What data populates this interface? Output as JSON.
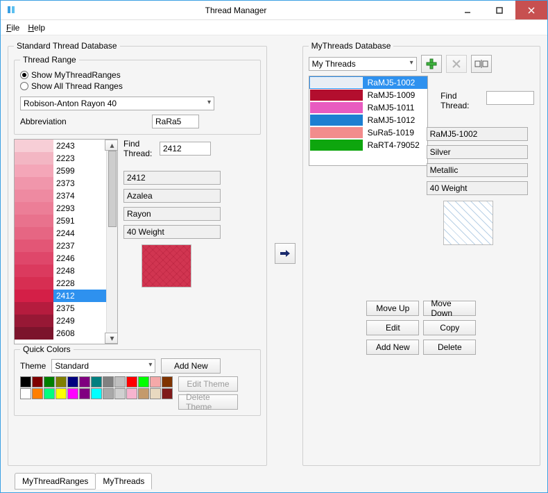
{
  "window": {
    "title": "Thread Manager"
  },
  "menu": {
    "file": "File",
    "help": "Help"
  },
  "left": {
    "group_title": "Standard Thread Database",
    "range_group_title": "Thread Range",
    "radio_my": "Show MyThreadRanges",
    "radio_all": "Show All Thread Ranges",
    "range_combo": "Robison-Anton Rayon 40",
    "abbrev_label": "Abbreviation",
    "abbrev_value": "RaRa5",
    "find_label": "Find Thread:",
    "find_value": "2412",
    "detail_id": "2412",
    "detail_name": "Azalea",
    "detail_material": "Rayon",
    "detail_weight": "40 Weight",
    "threads": [
      {
        "num": "2243",
        "color": "#f7ced6"
      },
      {
        "num": "2223",
        "color": "#f3b6c3"
      },
      {
        "num": "2599",
        "color": "#f4a6b8"
      },
      {
        "num": "2373",
        "color": "#f096ab"
      },
      {
        "num": "2374",
        "color": "#ee8aa1"
      },
      {
        "num": "2293",
        "color": "#ec7e97"
      },
      {
        "num": "2591",
        "color": "#e9728d"
      },
      {
        "num": "2244",
        "color": "#e66683"
      },
      {
        "num": "2237",
        "color": "#e35676"
      },
      {
        "num": "2246",
        "color": "#df476a"
      },
      {
        "num": "2248",
        "color": "#db3a5e"
      },
      {
        "num": "2228",
        "color": "#d72e52"
      },
      {
        "num": "2412",
        "color": "#d41f47",
        "selected": true
      },
      {
        "num": "2375",
        "color": "#b51c3e"
      },
      {
        "num": "2249",
        "color": "#971835"
      },
      {
        "num": "2608",
        "color": "#7c142c"
      }
    ],
    "scroll": {
      "thumb_top": 0,
      "thumb_height": 110
    },
    "quick_title": "Quick Colors",
    "theme_label": "Theme",
    "theme_value": "Standard",
    "btn_add_new": "Add New",
    "btn_edit_theme": "Edit Theme",
    "btn_delete_theme": "Delete Theme",
    "palette": [
      "#000000",
      "#7f0000",
      "#007f00",
      "#7f7f00",
      "#00007f",
      "#7f007f",
      "#007f7f",
      "#808080",
      "#c0c0c0",
      "#ff0000",
      "#00ff00",
      "#f5a9a9",
      "#7f3300",
      "#ffffff",
      "#ff7f00",
      "#00ff7f",
      "#ffff00",
      "#ff00ff",
      "#800080",
      "#00ffff",
      "#a9a9a9",
      "#d0d0d0",
      "#f7b4cf",
      "#c49a6c",
      "#e8d9c0",
      "#7f1a1a"
    ]
  },
  "middle": {},
  "right": {
    "group_title": "MyThreads Database",
    "combo_value": "My Threads",
    "find_label": "Find Thread:",
    "find_value": "",
    "threads": [
      {
        "label": "RaMJ5-1002",
        "color": "#e8eef5",
        "selected": true
      },
      {
        "label": "RaMJ5-1009",
        "color": "#b30e2e"
      },
      {
        "label": "RaMJ5-1011",
        "color": "#e85bc0"
      },
      {
        "label": "RaMJ5-1012",
        "color": "#1d7fd1"
      },
      {
        "label": "SuRa5-1019",
        "color": "#f28c8c"
      },
      {
        "label": "RaRT4-79052",
        "color": "#0ea60e"
      }
    ],
    "detail_id": "RaMJ5-1002",
    "detail_name": "Silver",
    "detail_material": "Metallic",
    "detail_weight": "40 Weight",
    "btn_moveup": "Move Up",
    "btn_movedown": "Move Down",
    "btn_edit": "Edit",
    "btn_copy": "Copy",
    "btn_addnew": "Add New",
    "btn_delete": "Delete"
  },
  "tabs": {
    "t1": "MyThreadRanges",
    "t2": "MyThreads"
  }
}
